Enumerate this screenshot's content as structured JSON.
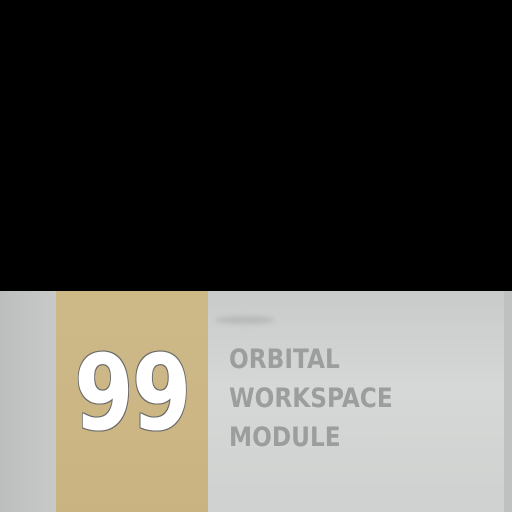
{
  "sign": {
    "number": "99",
    "label_lines": [
      "ORBITAL",
      "WORKSPACE",
      "MODULE"
    ]
  },
  "colors": {
    "background": "#000000",
    "panel": "#d2d4d3",
    "number_plate": "#ccb684",
    "number_text": "#ffffff",
    "label_text": "#9c9e9d"
  }
}
